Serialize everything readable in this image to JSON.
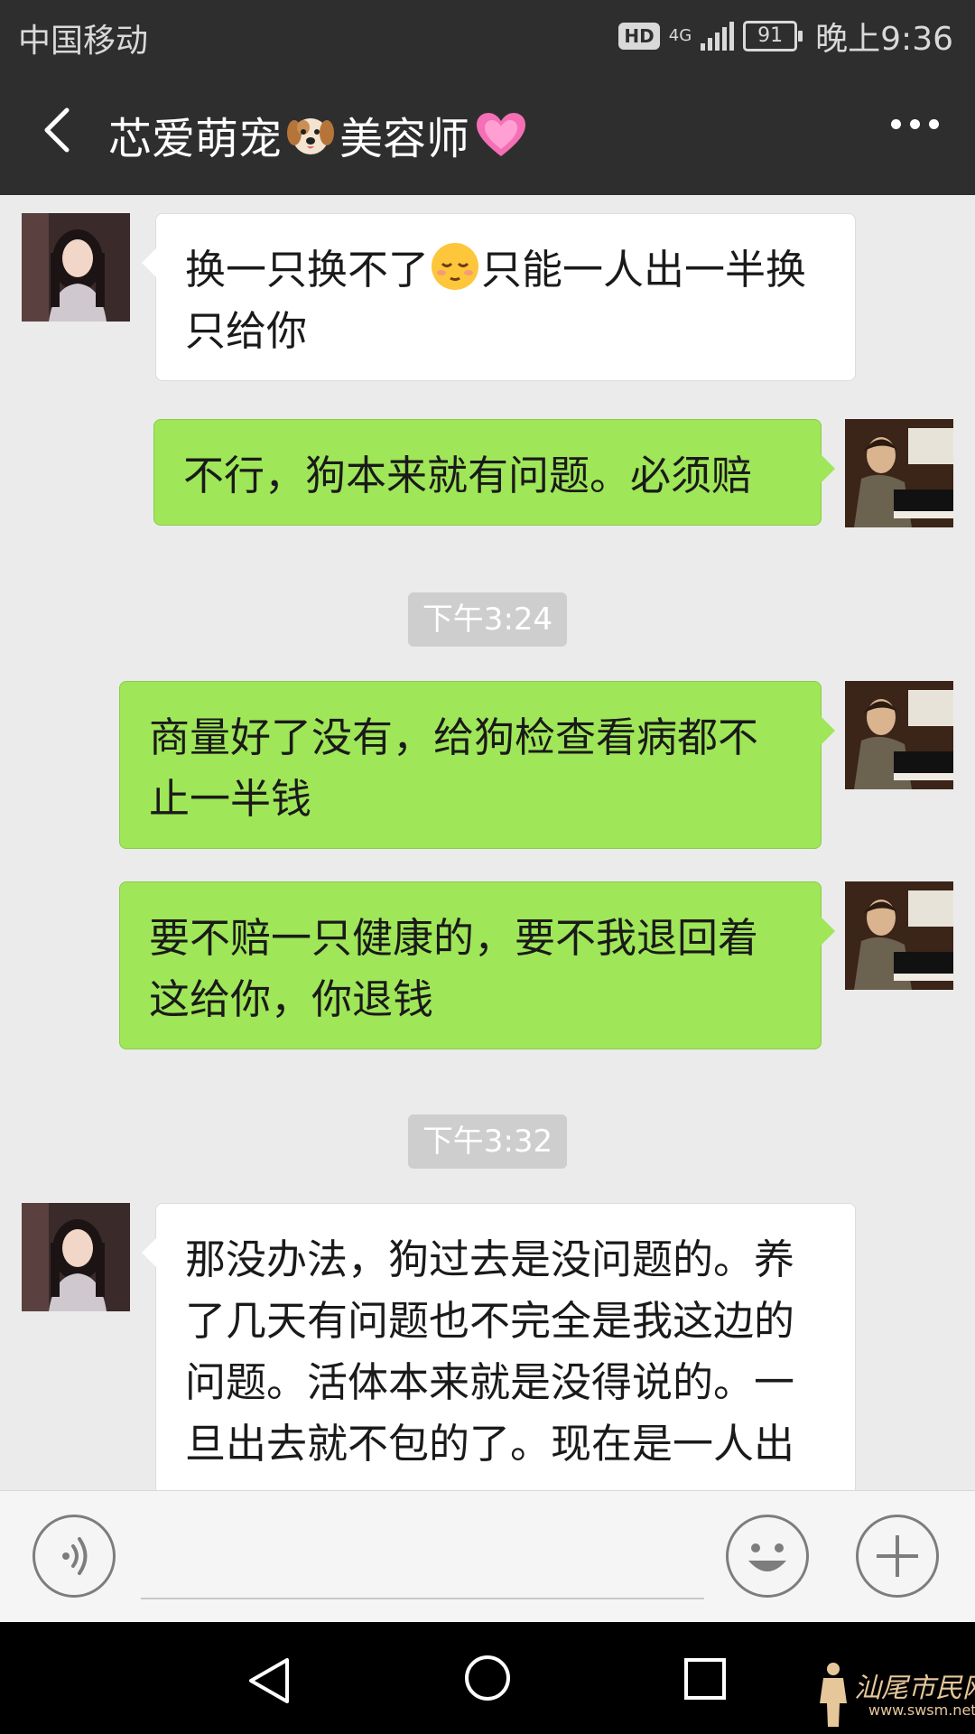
{
  "status_bar": {
    "carrier": "中国移动",
    "hd": "HD",
    "network": "4G",
    "battery": "91",
    "time": "晚上9:36"
  },
  "header": {
    "title_part1": "芯爱萌宠",
    "title_part2": "美容师",
    "icons": [
      "back-chevron-icon",
      "dog-face-emoji-icon",
      "heart-emoji-icon",
      "more-dots-icon"
    ]
  },
  "messages": [
    {
      "side": "in",
      "line1": "换一只换不了",
      "line1_after": "只能一人出一半换",
      "line2": "只给你",
      "emoji": "relieved-face-emoji"
    },
    {
      "side": "out",
      "line1": "不行，狗本来就有问题。必须赔"
    },
    {
      "timestamp": "下午3:24"
    },
    {
      "side": "out",
      "line1": "商量好了没有，给狗检查看病都不",
      "line2": "止一半钱"
    },
    {
      "side": "out",
      "line1": "要不赔一只健康的，要不我退回着",
      "line2": "这给你，你退钱"
    },
    {
      "timestamp": "下午3:32"
    },
    {
      "side": "in",
      "line1": "那没办法，狗过去是没问题的。养",
      "line2": "了几天有问题也不完全是我这边的",
      "line3": "问题。活体本来就是没得说的。一",
      "line4": "旦出去就不包的了。现在是一人出"
    }
  ],
  "input_bar": {
    "voice_icon": "voice-icon",
    "emoji_icon": "smiley-icon",
    "plus_icon": "plus-icon",
    "input_value": ""
  },
  "system_nav": [
    "back-triangle-icon",
    "home-circle-icon",
    "recents-square-icon"
  ],
  "watermark": {
    "text": "汕尾市民网",
    "url": "www.swsm.net"
  },
  "colors": {
    "bar": "#2e2e2e",
    "chat_bg": "#ebebeb",
    "sent_bubble": "#9fe658",
    "received_bubble": "#ffffff",
    "timestamp_bg": "#cecece"
  }
}
